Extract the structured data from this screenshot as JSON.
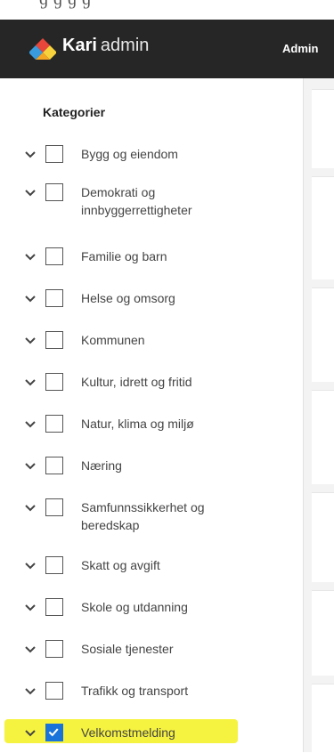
{
  "top_clip_text": "ɡ ɡ ɡ ɡ",
  "header": {
    "brand_bold": "Kari",
    "brand_light": "admin",
    "admin_link": "Admin"
  },
  "sidebar": {
    "title": "Kategorier",
    "categories": [
      {
        "label": "Bygg og eiendom",
        "checked": false
      },
      {
        "label": "Demokrati og innbyggerrettigheter",
        "checked": false
      },
      {
        "label": "Familie og barn",
        "checked": false
      },
      {
        "label": "Helse og omsorg",
        "checked": false
      },
      {
        "label": "Kommunen",
        "checked": false
      },
      {
        "label": "Kultur, idrett og fritid",
        "checked": false
      },
      {
        "label": "Natur, klima og miljø",
        "checked": false
      },
      {
        "label": "Næring",
        "checked": false
      },
      {
        "label": "Samfunnssikkerhet og beredskap",
        "checked": false
      },
      {
        "label": "Skatt og avgift",
        "checked": false
      },
      {
        "label": "Skole og utdanning",
        "checked": false
      },
      {
        "label": "Sosiale tjenester",
        "checked": false
      },
      {
        "label": "Trafikk og transport",
        "checked": false
      },
      {
        "label": "Velkomstmelding",
        "checked": true
      }
    ]
  },
  "colors": {
    "header_bg": "#262626",
    "checkbox_checked": "#1a73d9",
    "highlight": "#f6f340",
    "logo_red": "#e8463a",
    "logo_orange": "#f5a623",
    "logo_blue": "#3a9bdc",
    "logo_yellow": "#f7d23c"
  }
}
